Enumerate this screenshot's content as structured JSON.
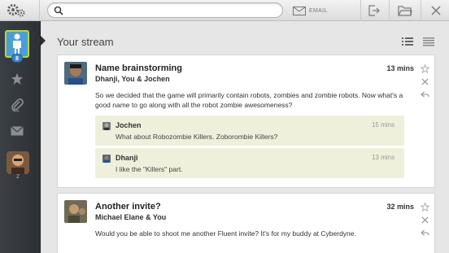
{
  "toolbar": {
    "search_placeholder": "",
    "email_label": "EMAIL"
  },
  "sidebar": {
    "me_badge": "8",
    "contact_count": "2"
  },
  "stream": {
    "title": "Your stream"
  },
  "posts": [
    {
      "title": "Name brainstorming",
      "people": "Dhanji, You & Jochen",
      "time": "13 mins",
      "body": "So we decided that the game will primarily contain robots, zombies and zombie robots. Now what's a good name to go along with all the robot zombie awesomeness?",
      "replies": [
        {
          "name": "Jochen",
          "time": "15 mins",
          "text": "What about Robozombie Killers. Zoborombie Killers?"
        },
        {
          "name": "Dhanji",
          "time": "13 mins",
          "text": "I like the \"Killers\" part."
        }
      ]
    },
    {
      "title": "Another invite?",
      "people": "Michael Elane & You",
      "time": "32 mins",
      "body": "Would you be able to shoot me another Fluent invite? It's for my buddy at Cyberdyne."
    }
  ]
}
